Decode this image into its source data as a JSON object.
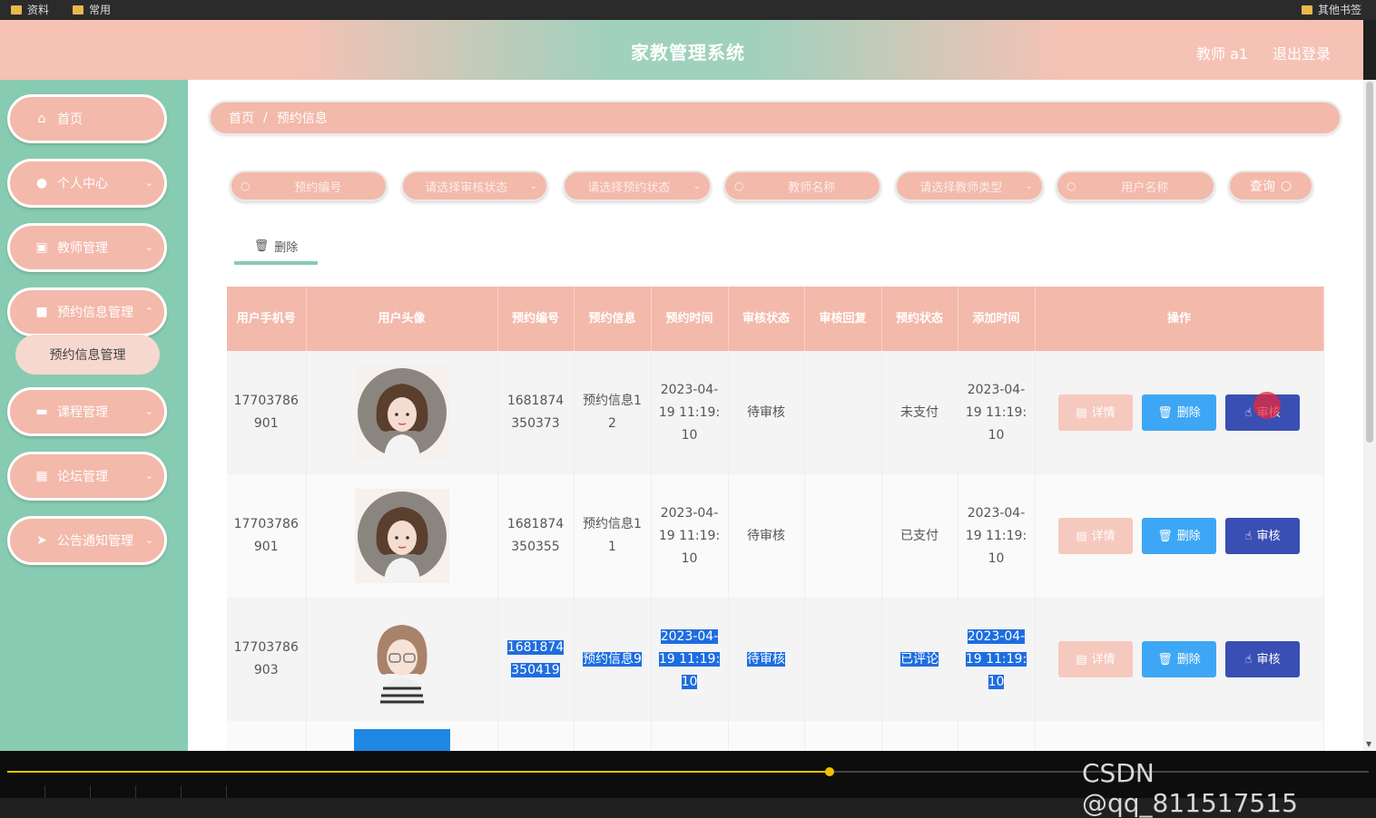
{
  "bookmarks": [
    {
      "label": "资料"
    },
    {
      "label": "常用"
    },
    {
      "label": "其他书签"
    }
  ],
  "header": {
    "title": "家教管理系统",
    "user": "教师 a1",
    "logout": "退出登录"
  },
  "sidebar": {
    "items": [
      {
        "label": "首页",
        "icon": "home-icon"
      },
      {
        "label": "个人中心",
        "icon": "user-icon"
      },
      {
        "label": "教师管理",
        "icon": "teacher-icon"
      },
      {
        "label": "预约信息管理",
        "icon": "appointment-icon"
      },
      {
        "label": "课程管理",
        "icon": "course-icon"
      },
      {
        "label": "论坛管理",
        "icon": "forum-icon"
      },
      {
        "label": "公告通知管理",
        "icon": "notice-icon"
      }
    ],
    "submenu": "预约信息管理"
  },
  "breadcrumb": {
    "home": "首页",
    "sep": "/",
    "current": "预约信息"
  },
  "filters": {
    "appointment_no": "预约编号",
    "review_status": "请选择审核状态",
    "appointment_status": "请选择预约状态",
    "teacher_name": "教师名称",
    "teacher_type": "请选择教师类型",
    "user_name": "用户名称",
    "query": "查询"
  },
  "toolbar": {
    "delete": "删除"
  },
  "table": {
    "headers": [
      "用户手机号",
      "用户头像",
      "预约编号",
      "预约信息",
      "预约时间",
      "审核状态",
      "审核回复",
      "预约状态",
      "添加时间",
      "操作"
    ],
    "rows": [
      {
        "phone": "17703786901",
        "no": "1681874350373",
        "info": "预约信息12",
        "time": "2023-04-19 11:19:10",
        "review": "待审核",
        "reply": "",
        "status": "未支付",
        "added": "2023-04-19 11:19:10"
      },
      {
        "phone": "17703786901",
        "no": "1681874350355",
        "info": "预约信息11",
        "time": "2023-04-19 11:19:10",
        "review": "待审核",
        "reply": "",
        "status": "已支付",
        "added": "2023-04-19 11:19:10"
      },
      {
        "phone": "17703786903",
        "no": "1681874350419",
        "info": "预约信息9",
        "time": "2023-04-19 11:19:10",
        "review": "待审核",
        "reply": "",
        "status": "已评论",
        "added": "2023-04-19 11:19:10"
      }
    ],
    "actions": {
      "detail": "详情",
      "delete": "删除",
      "review": "审核"
    }
  },
  "video": {
    "watermark": "CSDN @qq_811517515",
    "progress": 0.604
  },
  "colors": {
    "pink": "#f3b9ab",
    "mint": "#88cbb3",
    "blue": "#3da7f5",
    "indigo": "#3a4fb3"
  }
}
